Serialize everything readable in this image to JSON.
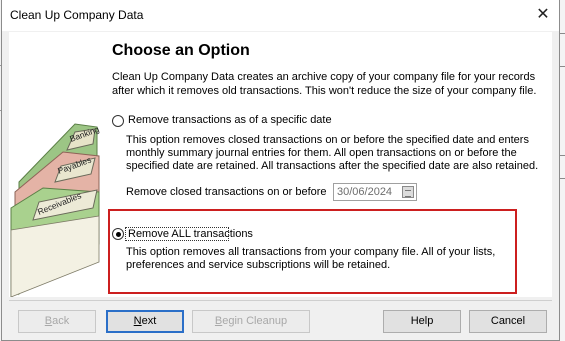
{
  "window": {
    "title": "Clean Up Company Data",
    "close_glyph": "✕"
  },
  "illustration": {
    "tabs": [
      "Banking",
      "Payables",
      "Receivables"
    ]
  },
  "page": {
    "heading": "Choose an Option",
    "intro": "Clean Up Company Data creates an archive copy of your company file for your records after which it removes old transactions. This won't reduce the size of your company file."
  },
  "options": [
    {
      "label": "Remove transactions as of a specific date",
      "selected": false,
      "description": "This option removes closed transactions on or before the specified date and enters monthly summary journal entries for them.  All open transactions on or before the specified date are retained.  All transactions after the specified date are also retained.",
      "date_label": "Remove closed transactions on or before",
      "date_value": "30/06/2024"
    },
    {
      "label": "Remove ALL transactions",
      "selected": true,
      "description": "This option removes all transactions from your company file.  All of your lists, preferences and service subscriptions will be retained."
    }
  ],
  "buttons": {
    "back": {
      "pre": "",
      "accel": "B",
      "post": "ack"
    },
    "next": {
      "pre": "",
      "accel": "N",
      "post": "ext"
    },
    "begin": {
      "pre": "",
      "accel": "B",
      "post": "egin Cleanup"
    },
    "help": {
      "label": "Help"
    },
    "cancel": {
      "label": "Cancel"
    }
  },
  "colors": {
    "highlight_border": "#cc1f1f",
    "primary_button_border": "#2b6fc8",
    "folder_green": "#a9d18e"
  }
}
